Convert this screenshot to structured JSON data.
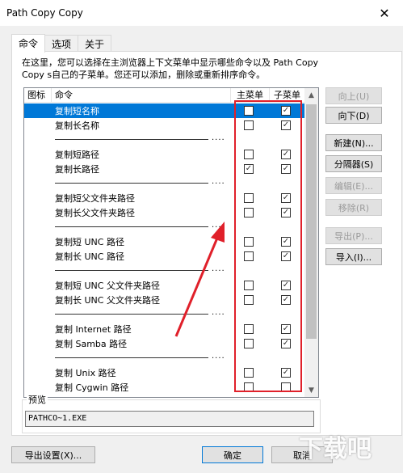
{
  "window": {
    "title": "Path Copy Copy",
    "close_icon": "close-icon"
  },
  "tabs": [
    {
      "label": "命令"
    },
    {
      "label": "选项"
    },
    {
      "label": "关于"
    }
  ],
  "description": "在这里，您可以选择在主浏览器上下文菜单中显示哪些命令以及 Path Copy Copy s自己的子菜单。您还可以添加，删除或重新排序命令。",
  "list": {
    "headers": {
      "icon": "图标",
      "command": "命令",
      "main_menu": "主菜单",
      "submenu": "子菜单"
    },
    "separator_dots": "....",
    "rows": [
      {
        "type": "item",
        "name": "复制短名称",
        "main": false,
        "sub": true,
        "selected": true
      },
      {
        "type": "item",
        "name": "复制长名称",
        "main": false,
        "sub": true
      },
      {
        "type": "sep"
      },
      {
        "type": "item",
        "name": "复制短路径",
        "main": false,
        "sub": true
      },
      {
        "type": "item",
        "name": "复制长路径",
        "main": true,
        "sub": true
      },
      {
        "type": "sep"
      },
      {
        "type": "item",
        "name": "复制短父文件夹路径",
        "main": false,
        "sub": true
      },
      {
        "type": "item",
        "name": "复制长父文件夹路径",
        "main": false,
        "sub": true
      },
      {
        "type": "sep"
      },
      {
        "type": "item",
        "name": "复制短 UNC 路径",
        "main": false,
        "sub": true
      },
      {
        "type": "item",
        "name": "复制长 UNC 路径",
        "main": false,
        "sub": true
      },
      {
        "type": "sep"
      },
      {
        "type": "item",
        "name": "复制短 UNC 父文件夹路径",
        "main": false,
        "sub": true
      },
      {
        "type": "item",
        "name": "复制长 UNC 父文件夹路径",
        "main": false,
        "sub": true
      },
      {
        "type": "sep"
      },
      {
        "type": "item",
        "name": "复制 Internet 路径",
        "main": false,
        "sub": true
      },
      {
        "type": "item",
        "name": "复制 Samba 路径",
        "main": false,
        "sub": true
      },
      {
        "type": "sep"
      },
      {
        "type": "item",
        "name": "复制 Unix 路径",
        "main": false,
        "sub": true
      },
      {
        "type": "item",
        "name": "复制 Cygwin 路径",
        "main": false,
        "sub": false
      }
    ]
  },
  "side_buttons": {
    "up": "向上(U)",
    "down": "向下(D)",
    "new": "新建(N)...",
    "separator": "分隔器(S)",
    "edit": "编辑(E)...",
    "remove": "移除(R)",
    "export": "导出(P)...",
    "import": "导入(I)..."
  },
  "preview": {
    "label": "预览",
    "value": "PATHCO~1.EXE"
  },
  "bottom": {
    "export_settings": "导出设置(X)...",
    "ok": "确定",
    "cancel": "取消"
  },
  "watermark": {
    "text": "下载吧"
  },
  "colors": {
    "selection": "#0078d7",
    "annotation": "#e0202a"
  }
}
